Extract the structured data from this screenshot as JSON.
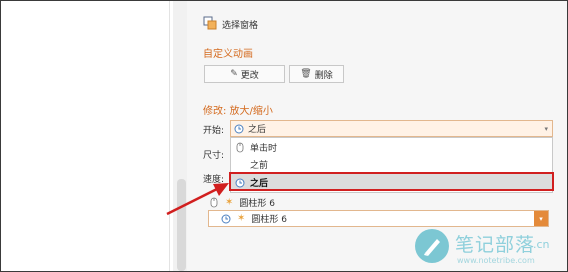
{
  "panel": {
    "selection_pane": "选择窗格",
    "section_title": "自定义动画",
    "change_button": "更改",
    "delete_button": "删除",
    "modify_label": "修改: 放大/缩小",
    "start_label": "开始:",
    "start_value": "之后",
    "size_label": "尺寸:",
    "speed_label": "速度:"
  },
  "dropdown": {
    "options": [
      "单击时",
      "之前",
      "之后"
    ],
    "selected": "之后"
  },
  "animation_list": {
    "items": [
      "圆柱形 6",
      "圆柱形 6"
    ]
  },
  "watermark": {
    "title": "笔记部落",
    "suffix": ".cn",
    "url": "www.notetribe.com"
  },
  "colors": {
    "accent": "#d46a1e",
    "highlight": "#d11f1f"
  }
}
